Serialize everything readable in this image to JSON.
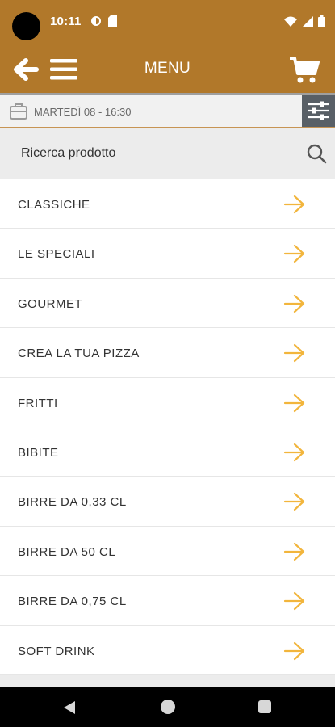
{
  "status_bar": {
    "time": "10:11"
  },
  "app_bar": {
    "title": "MENU"
  },
  "date_bar": {
    "label": "MARTEDÌ 08 - 16:30"
  },
  "search": {
    "placeholder": "Ricerca prodotto"
  },
  "categories": [
    {
      "label": "CLASSICHE"
    },
    {
      "label": "LE SPECIALI"
    },
    {
      "label": "GOURMET"
    },
    {
      "label": "CREA LA TUA PIZZA"
    },
    {
      "label": "FRITTI"
    },
    {
      "label": "BIBITE"
    },
    {
      "label": "BIRRE DA 0,33 CL"
    },
    {
      "label": "BIRRE DA 50 CL"
    },
    {
      "label": "BIRRE DA 0,75 CL"
    },
    {
      "label": "SOFT DRINK"
    }
  ],
  "colors": {
    "brand": "#b1782a",
    "arrow_accent": "#f2b53c",
    "filter_button": "#585f66"
  },
  "icons": {
    "back": "arrow-left-icon",
    "menu": "hamburger-icon",
    "cart": "cart-icon",
    "date": "shopping-bag-icon",
    "filter": "sliders-icon",
    "search": "search-icon",
    "row": "arrow-right-icon"
  }
}
